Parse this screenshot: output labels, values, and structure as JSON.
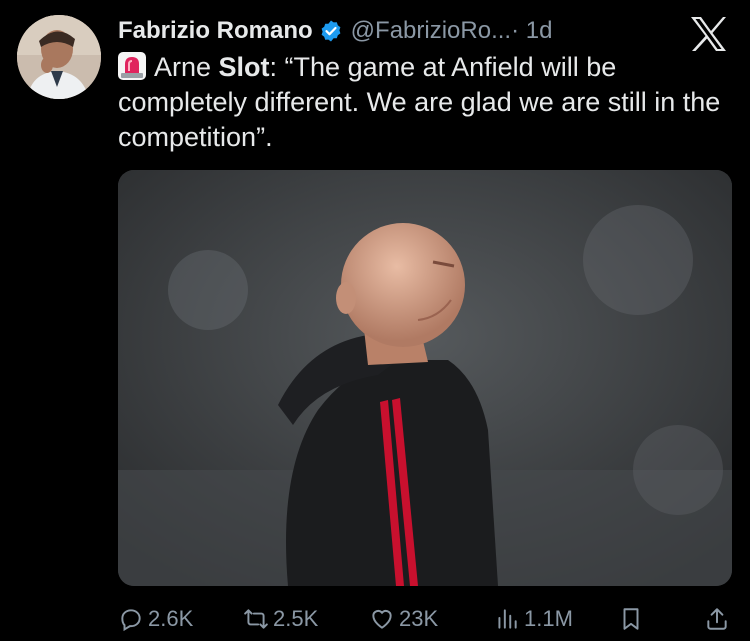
{
  "author": {
    "name": "Fabrizio Romano",
    "handle": "@FabrizioRo...",
    "time": "· 1d"
  },
  "tweet": {
    "text_before": "Arne ",
    "text_bold": "Slot",
    "text_after": ": “The game at Anfield will be completely different. We are glad we are still in the competition”."
  },
  "stats": {
    "replies": "2.6K",
    "retweets": "2.5K",
    "likes": "23K",
    "views": "1.1M"
  },
  "icons": {
    "verified": "verified-badge-icon",
    "platform": "x-logo-icon",
    "emoji": "police-siren-icon"
  },
  "colors": {
    "background": "#000000",
    "text": "#e7e9ea",
    "muted": "#8b98a5",
    "verified": "#1d9bf0"
  }
}
